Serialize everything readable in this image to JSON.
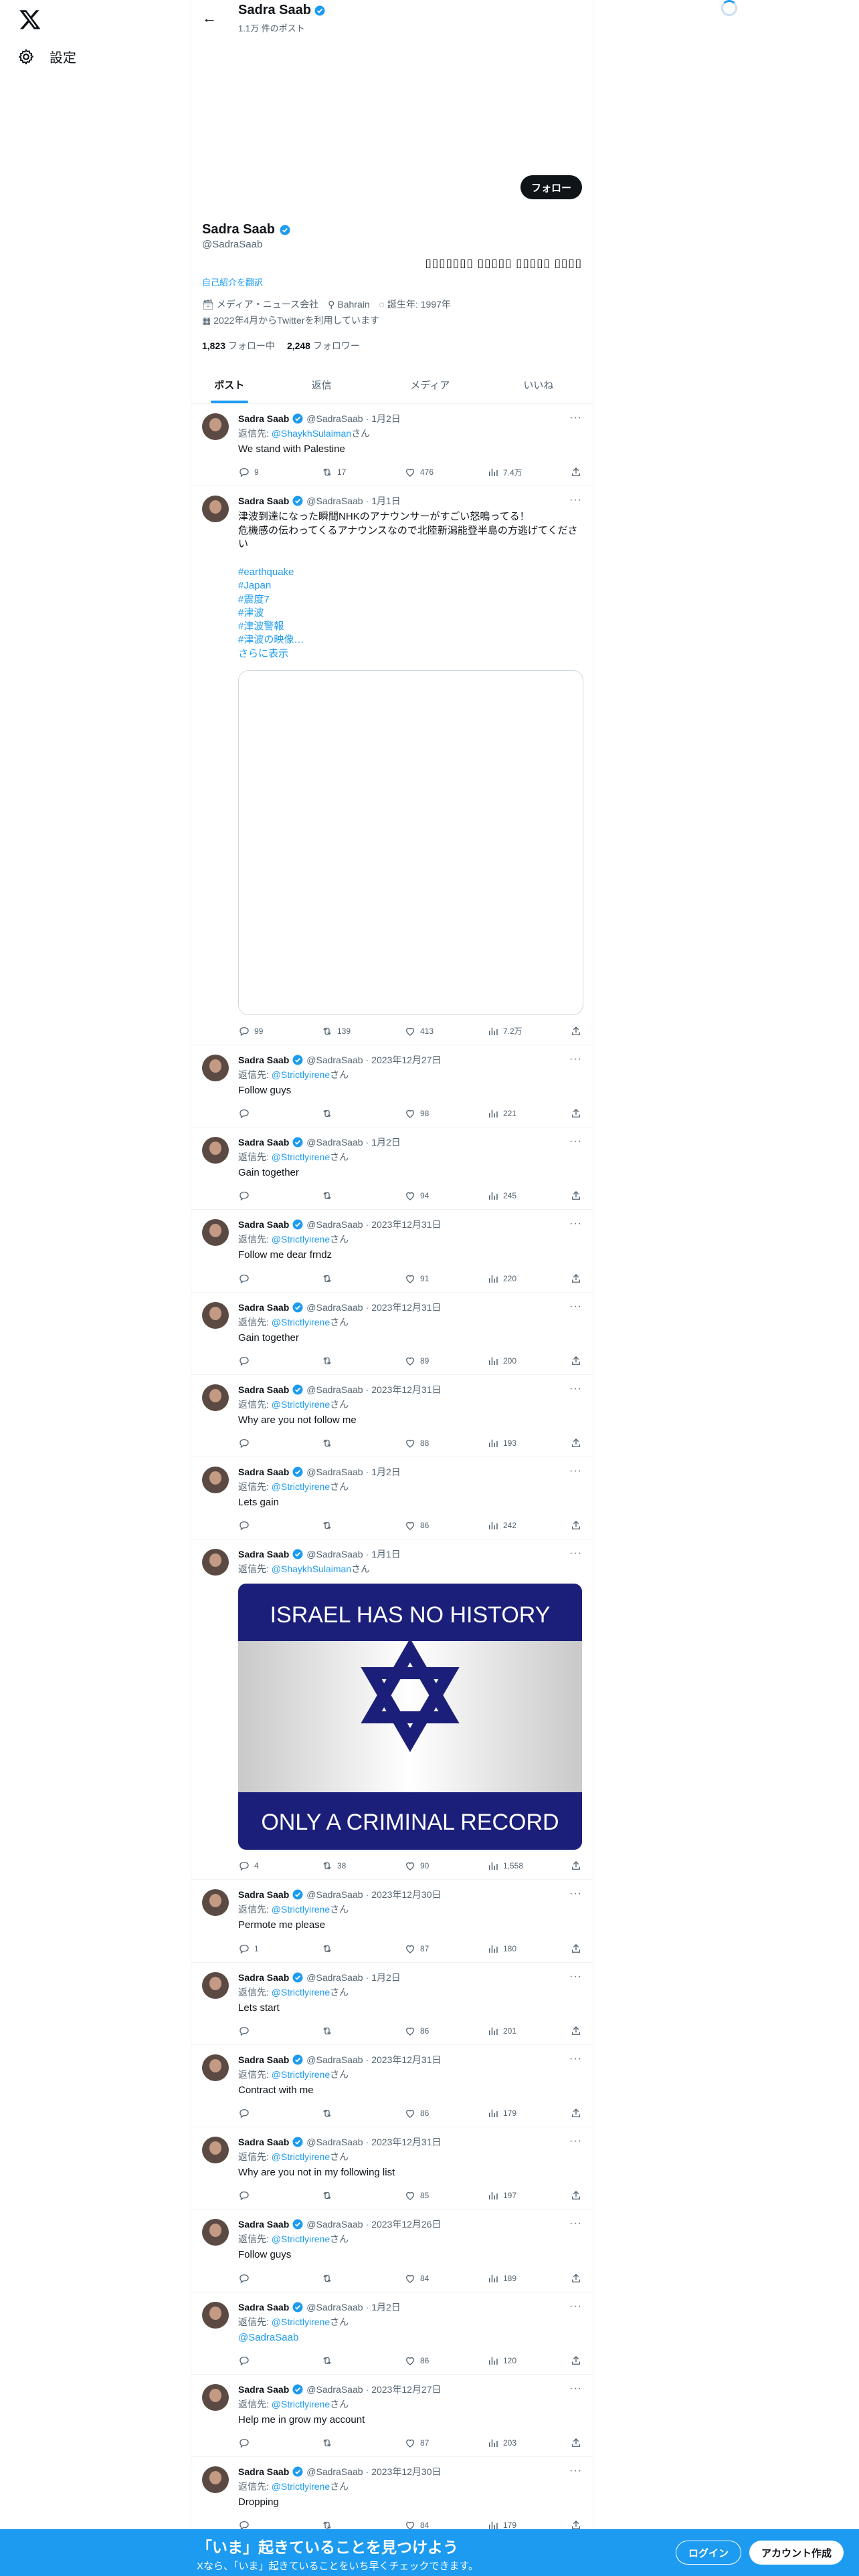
{
  "nav": {
    "settings_label": "設定"
  },
  "header": {
    "name": "Sadra Saab",
    "post_count": "1.1万 件のポスト"
  },
  "profile": {
    "follow_label": "フォロー",
    "name": "Sadra Saab",
    "handle": "@SadraSaab",
    "bio": "▯▯▯▯▯▯▯ ▯▯▯▯▯ ▯▯▯▯▯ ▯▯▯▯",
    "translate_label": "自己紹介を翻訳",
    "category": "メディア・ニュース会社",
    "location": "Bahrain",
    "birthday": "誕生年: 1997年",
    "joined": "2022年4月からTwitterを利用しています",
    "following_count": "1,823",
    "following_label": "フォロー中",
    "followers_count": "2,248",
    "followers_label": "フォロワー"
  },
  "tabs": [
    "ポスト",
    "返信",
    "メディア",
    "いいね"
  ],
  "colors": {
    "accent": "#1d9bf0",
    "text": "#0f1419",
    "muted": "#536471",
    "border": "#eff3f4"
  },
  "tweets": [
    {
      "name": "Sadra Saab",
      "handle": "@SadraSaab",
      "time": "1月2日",
      "reply_prefix": "返信先: ",
      "reply_to": "@ShaykhSulaiman",
      "reply_suffix": "さん",
      "text": "We stand with Palestine",
      "replies": "9",
      "retweets": "17",
      "likes": "476",
      "views": "7.4万"
    },
    {
      "name": "Sadra Saab",
      "handle": "@SadraSaab",
      "time": "1月1日",
      "text": "津波到達になった瞬間NHKのアナウンサーがすごい怒鳴ってる！\n危機感の伝わってくるアナウンスなので北陸新潟能登半島の方逃げてください",
      "tags": [
        "#earthquake",
        "#Japan",
        "#震度7",
        "#津波",
        "#津波警報",
        "#津波の映像…"
      ],
      "show_more": "さらに表示",
      "replies": "99",
      "retweets": "139",
      "likes": "413",
      "views": "7.2万"
    },
    {
      "name": "Sadra Saab",
      "handle": "@SadraSaab",
      "time": "2023年12月27日",
      "reply_prefix": "返信先: ",
      "reply_to": "@Strictlyirene",
      "reply_suffix": "さん",
      "text": "Follow guys",
      "replies": "",
      "retweets": "",
      "likes": "98",
      "views": "221"
    },
    {
      "name": "Sadra Saab",
      "handle": "@SadraSaab",
      "time": "1月2日",
      "reply_prefix": "返信先: ",
      "reply_to": "@Strictlyirene",
      "reply_suffix": "さん",
      "text": "Gain together",
      "replies": "",
      "retweets": "",
      "likes": "94",
      "views": "245"
    },
    {
      "name": "Sadra Saab",
      "handle": "@SadraSaab",
      "time": "2023年12月31日",
      "reply_prefix": "返信先: ",
      "reply_to": "@Strictlyirene",
      "reply_suffix": "さん",
      "text": "Follow me dear frndz",
      "replies": "",
      "retweets": "",
      "likes": "91",
      "views": "220"
    },
    {
      "name": "Sadra Saab",
      "handle": "@SadraSaab",
      "time": "2023年12月31日",
      "reply_prefix": "返信先: ",
      "reply_to": "@Strictlyirene",
      "reply_suffix": "さん",
      "text": "Gain together",
      "replies": "",
      "retweets": "",
      "likes": "89",
      "views": "200"
    },
    {
      "name": "Sadra Saab",
      "handle": "@SadraSaab",
      "time": "2023年12月31日",
      "reply_prefix": "返信先: ",
      "reply_to": "@Strictlyirene",
      "reply_suffix": "さん",
      "text": "Why are you not follow me",
      "replies": "",
      "retweets": "",
      "likes": "88",
      "views": "193"
    },
    {
      "name": "Sadra Saab",
      "handle": "@SadraSaab",
      "time": "1月2日",
      "reply_prefix": "返信先: ",
      "reply_to": "@Strictlyirene",
      "reply_suffix": "さん",
      "text": "Lets gain",
      "replies": "",
      "retweets": "",
      "likes": "86",
      "views": "242"
    },
    {
      "name": "Sadra Saab",
      "handle": "@SadraSaab",
      "time": "1月1日",
      "reply_prefix": "返信先: ",
      "reply_to": "@ShaykhSulaiman",
      "reply_suffix": "さん",
      "text": "",
      "image": {
        "top_text": "ISRAEL HAS NO HISTORY",
        "bottom_text": "ONLY A CRIMINAL RECORD"
      },
      "replies": "4",
      "retweets": "38",
      "likes": "90",
      "views": "1,558"
    },
    {
      "name": "Sadra Saab",
      "handle": "@SadraSaab",
      "time": "2023年12月30日",
      "reply_prefix": "返信先: ",
      "reply_to": "@Strictlyirene",
      "reply_suffix": "さん",
      "text": "Permote me please",
      "replies": "1",
      "retweets": "",
      "likes": "87",
      "views": "180"
    },
    {
      "name": "Sadra Saab",
      "handle": "@SadraSaab",
      "time": "1月2日",
      "reply_prefix": "返信先: ",
      "reply_to": "@Strictlyirene",
      "reply_suffix": "さん",
      "text": "Lets start",
      "replies": "",
      "retweets": "",
      "likes": "86",
      "views": "201"
    },
    {
      "name": "Sadra Saab",
      "handle": "@SadraSaab",
      "time": "2023年12月31日",
      "reply_prefix": "返信先: ",
      "reply_to": "@Strictlyirene",
      "reply_suffix": "さん",
      "text": "Contract with me",
      "replies": "",
      "retweets": "",
      "likes": "86",
      "views": "179"
    },
    {
      "name": "Sadra Saab",
      "handle": "@SadraSaab",
      "time": "2023年12月31日",
      "reply_prefix": "返信先: ",
      "reply_to": "@Strictlyirene",
      "reply_suffix": "さん",
      "text": "Why are you not in my following list",
      "replies": "",
      "retweets": "",
      "likes": "85",
      "views": "197"
    },
    {
      "name": "Sadra Saab",
      "handle": "@SadraSaab",
      "time": "2023年12月26日",
      "reply_prefix": "返信先: ",
      "reply_to": "@Strictlyirene",
      "reply_suffix": "さん",
      "text": "Follow guys",
      "replies": "",
      "retweets": "",
      "likes": "84",
      "views": "189"
    },
    {
      "name": "Sadra Saab",
      "handle": "@SadraSaab",
      "time": "1月2日",
      "reply_prefix": "返信先: ",
      "reply_to": "@Strictlyirene",
      "reply_suffix": "さん",
      "text": "@SadraSaab",
      "text_is_link": true,
      "replies": "",
      "retweets": "",
      "likes": "86",
      "views": "120"
    },
    {
      "name": "Sadra Saab",
      "handle": "@SadraSaab",
      "time": "2023年12月27日",
      "reply_prefix": "返信先: ",
      "reply_to": "@Strictlyirene",
      "reply_suffix": "さん",
      "text": "Help me in grow my account",
      "replies": "",
      "retweets": "",
      "likes": "87",
      "views": "203"
    },
    {
      "name": "Sadra Saab",
      "handle": "@SadraSaab",
      "time": "2023年12月30日",
      "reply_prefix": "返信先: ",
      "reply_to": "@Strictlyirene",
      "reply_suffix": "さん",
      "text": "Dropping",
      "replies": "",
      "retweets": "",
      "likes": "84",
      "views": "179"
    }
  ],
  "bottom_bar": {
    "title": "「いま」起きていることを見つけよう",
    "subtitle": "Xなら、「いま」起きていることをいち早くチェックできます。",
    "login_label": "ログイン",
    "signup_label": "アカウント作成"
  }
}
